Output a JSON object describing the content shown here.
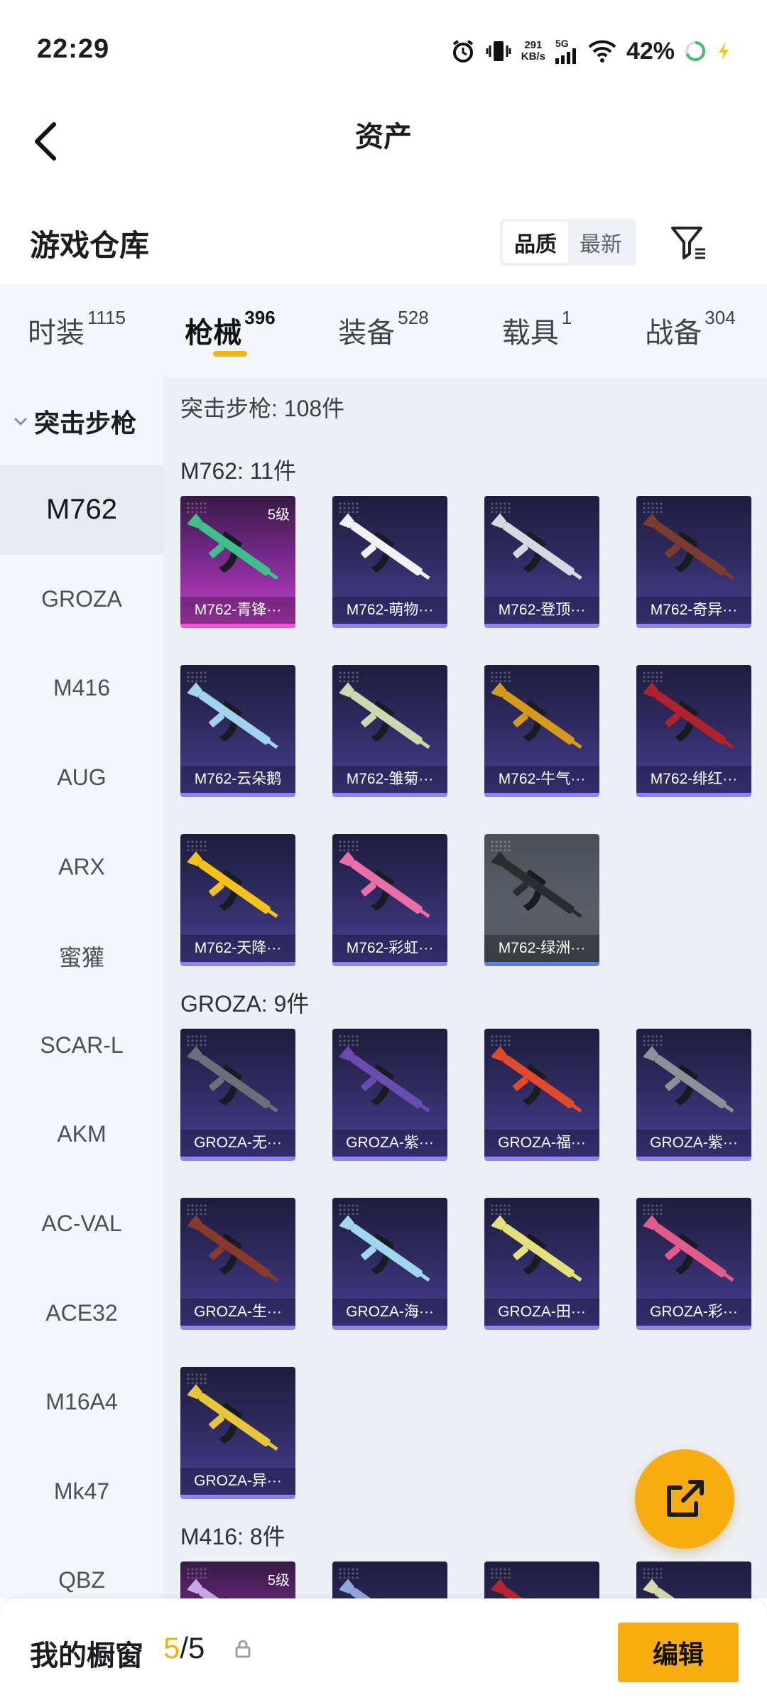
{
  "status_bar": {
    "time": "22:29",
    "net_speed_value": "291",
    "net_speed_unit": "KB/s",
    "network": "5G",
    "battery": "42%"
  },
  "header": {
    "title": "资产"
  },
  "warehouse": {
    "title": "游戏仓库",
    "sort_options": [
      "品质",
      "最新"
    ],
    "active_sort": "品质"
  },
  "tabs": [
    {
      "label": "时装",
      "count": "1115"
    },
    {
      "label": "枪械",
      "count": "396",
      "active": true
    },
    {
      "label": "装备",
      "count": "528"
    },
    {
      "label": "载具",
      "count": "1"
    },
    {
      "label": "战备",
      "count": "304"
    }
  ],
  "sidebar": {
    "group": "突击步枪",
    "items": [
      "M762",
      "GROZA",
      "M416",
      "AUG",
      "ARX",
      "蜜獾",
      "SCAR-L",
      "AKM",
      "AC-VAL",
      "ACE32",
      "M16A4",
      "Mk47",
      "QBZ"
    ],
    "active": "M762"
  },
  "content": {
    "section_summary": "突击步枪: 108件",
    "groups": [
      {
        "label": "M762: 11件",
        "items": [
          {
            "name": "M762-青锋···",
            "rarity": "pink",
            "level": "5级",
            "gun_color": "#3fbf8a"
          },
          {
            "name": "M762-萌物···",
            "rarity": "purple",
            "gun_color": "#f2f2f5"
          },
          {
            "name": "M762-登顶···",
            "rarity": "purple",
            "gun_color": "#d8d8e0"
          },
          {
            "name": "M762-奇异···",
            "rarity": "purple",
            "gun_color": "#7a3c2f"
          },
          {
            "name": "M762-云朵鹅",
            "rarity": "purple",
            "gun_color": "#9fd3ee"
          },
          {
            "name": "M762-雏菊···",
            "rarity": "purple",
            "gun_color": "#c9d9b0"
          },
          {
            "name": "M762-牛气···",
            "rarity": "purple",
            "gun_color": "#d59a1c"
          },
          {
            "name": "M762-绯红···",
            "rarity": "purple",
            "gun_color": "#b0222e"
          },
          {
            "name": "M762-天降···",
            "rarity": "purple",
            "gun_color": "#f4c21a"
          },
          {
            "name": "M762-彩虹···",
            "rarity": "purple",
            "gun_color": "#e96fa6"
          },
          {
            "name": "M762-绿洲···",
            "rarity": "grey",
            "gun_color": "#2a2c30"
          }
        ]
      },
      {
        "label": "GROZA: 9件",
        "items": [
          {
            "name": "GROZA-无···",
            "rarity": "purple",
            "gun_color": "#6c6e7a"
          },
          {
            "name": "GROZA-紫···",
            "rarity": "purple",
            "gun_color": "#6a4bb0"
          },
          {
            "name": "GROZA-福···",
            "rarity": "purple",
            "gun_color": "#e2492a"
          },
          {
            "name": "GROZA-紫···",
            "rarity": "purple",
            "gun_color": "#8f8f99"
          },
          {
            "name": "GROZA-生···",
            "rarity": "purple",
            "gun_color": "#8a3a2c"
          },
          {
            "name": "GROZA-海···",
            "rarity": "purple",
            "gun_color": "#9fd6f0"
          },
          {
            "name": "GROZA-田···",
            "rarity": "purple",
            "gun_color": "#e6e07a"
          },
          {
            "name": "GROZA-彩···",
            "rarity": "purple",
            "gun_color": "#e45b8a"
          },
          {
            "name": "GROZA-异···",
            "rarity": "purple",
            "gun_color": "#e8c53a"
          }
        ]
      },
      {
        "label": "M416: 8件",
        "items": [
          {
            "name": "",
            "rarity": "pink",
            "level": "5级",
            "gun_color": "#c9a7e8"
          },
          {
            "name": "",
            "rarity": "purple",
            "gun_color": "#8fa8e0"
          },
          {
            "name": "",
            "rarity": "purple",
            "gun_color": "#b5262e"
          },
          {
            "name": "",
            "rarity": "purple",
            "gun_color": "#d8d8b0"
          }
        ]
      }
    ]
  },
  "fab": {
    "icon": "share-icon"
  },
  "bottom_bar": {
    "label": "我的橱窗",
    "current": "5",
    "total": "/5",
    "edit_label": "编辑"
  }
}
